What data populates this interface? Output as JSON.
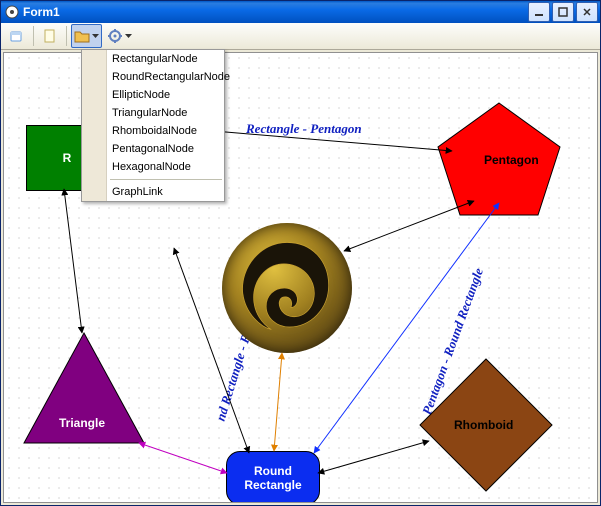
{
  "window": {
    "title": "Form1"
  },
  "toolbar": {
    "open_icon": "open-icon",
    "new_icon": "new-icon",
    "folder_icon": "folder-icon",
    "gear_icon": "gear-icon"
  },
  "menu": {
    "items": [
      "RectangularNode",
      "RoundRectangularNode",
      "EllipticNode",
      "TriangularNode",
      "RhomboidalNode",
      "PentagonalNode",
      "HexagonalNode"
    ],
    "sep_after": 6,
    "extra": "GraphLink"
  },
  "nodes": {
    "rectangle": {
      "label": "R"
    },
    "pentagon": {
      "label": "Pentagon",
      "fill": "#ff0000"
    },
    "triangle": {
      "label": "Triangle",
      "fill": "#800080"
    },
    "rhomboid": {
      "label": "Rhomboid",
      "fill": "#8B4513"
    },
    "roundrect": {
      "label": "Round Rectangle",
      "fill": "#0b2df0"
    }
  },
  "edges": {
    "rect_pentagon": "Rectangle - Pentagon",
    "rr_rect": "nd Rectangle - Rectangle",
    "pent_rr": "Pentagon - Round Rectangle"
  }
}
